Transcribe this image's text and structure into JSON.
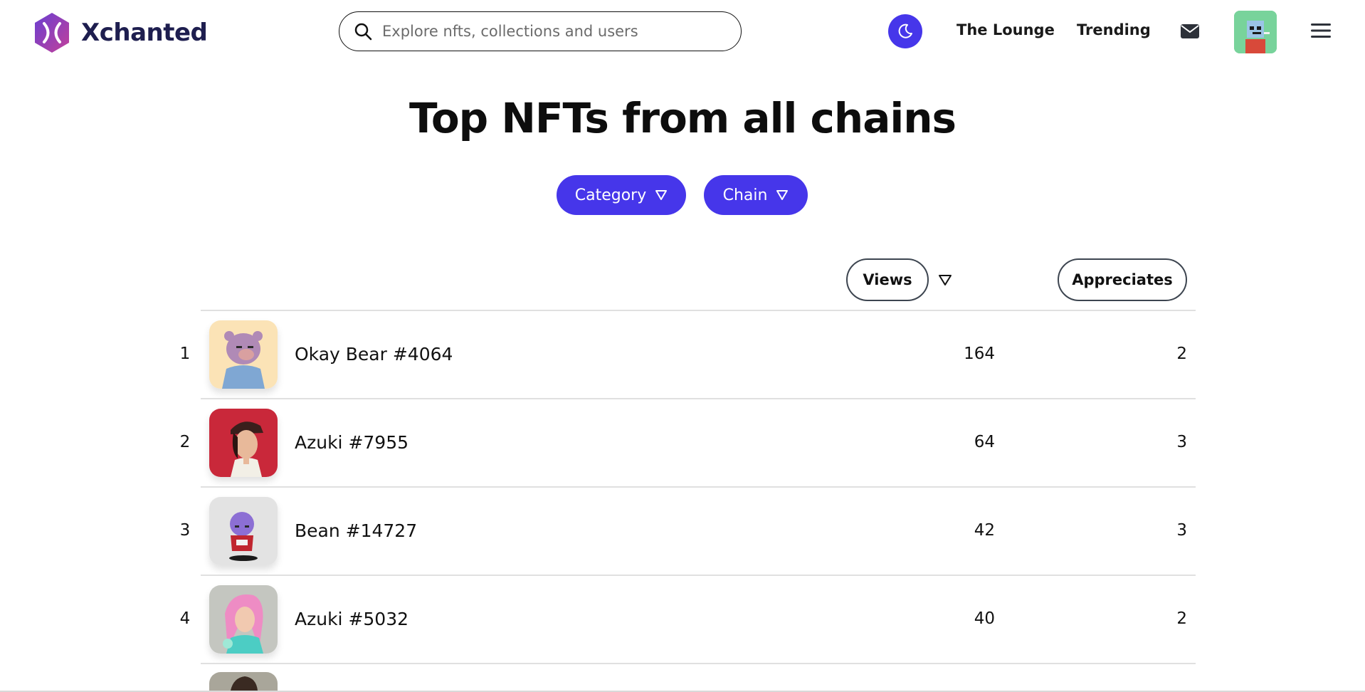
{
  "header": {
    "logo_text": "Xchanted",
    "search_placeholder": "Explore nfts, collections and users",
    "nav": [
      "The Lounge",
      "Trending"
    ],
    "icons": [
      "xchanted-logo-icon",
      "search-icon",
      "moon-icon",
      "mail-icon",
      "avatar",
      "hamburger-menu-icon"
    ]
  },
  "page": {
    "title": "Top NFTs from all chains"
  },
  "filters": {
    "category_label": "Category",
    "chain_label": "Chain"
  },
  "columns": {
    "views": "Views",
    "appreciates": "Appreciates"
  },
  "rows": [
    {
      "rank": "1",
      "name": "Okay Bear #4064",
      "views": "164",
      "appreciates": "2"
    },
    {
      "rank": "2",
      "name": "Azuki #7955",
      "views": "64",
      "appreciates": "3"
    },
    {
      "rank": "3",
      "name": "Bean #14727",
      "views": "42",
      "appreciates": "3"
    },
    {
      "rank": "4",
      "name": "Azuki #5032",
      "views": "40",
      "appreciates": "2"
    }
  ],
  "colors": {
    "accent": "#4636ea",
    "brand_dark": "#1e1e4f"
  }
}
